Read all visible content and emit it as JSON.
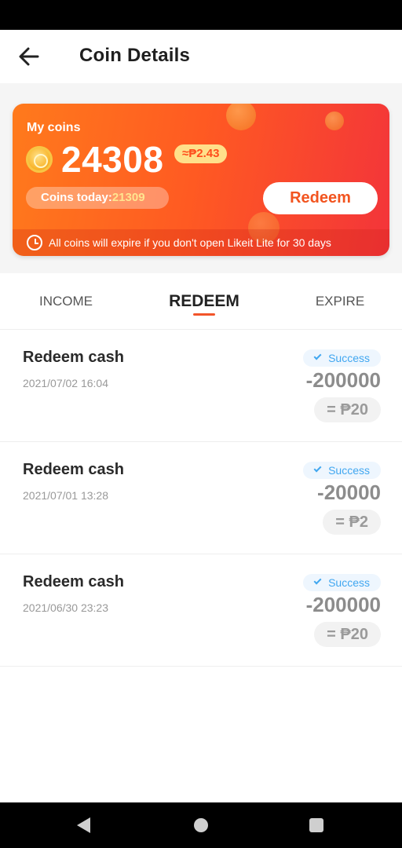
{
  "header": {
    "title": "Coin Details"
  },
  "card": {
    "my_coins_label": "My coins",
    "amount": "24308",
    "approx": "≈₱2.43",
    "today_label": "Coins today:",
    "today_value": "21309",
    "redeem_label": "Redeem",
    "expire_notice": "All coins will expire if you don't open Likeit Lite for 30 days"
  },
  "tabs": [
    {
      "label": "INCOME"
    },
    {
      "label": "REDEEM"
    },
    {
      "label": "EXPIRE"
    }
  ],
  "active_tab": "REDEEM",
  "records": [
    {
      "title": "Redeem cash",
      "date": "2021/07/02 16:04",
      "status": "Success",
      "amount": "-200000",
      "cash": "= ₱20"
    },
    {
      "title": "Redeem cash",
      "date": "2021/07/01 13:28",
      "status": "Success",
      "amount": "-20000",
      "cash": "= ₱2"
    },
    {
      "title": "Redeem cash",
      "date": "2021/06/30 23:23",
      "status": "Success",
      "amount": "-200000",
      "cash": "= ₱20"
    }
  ],
  "colors": {
    "accent": "#f2541f",
    "card_start": "#ff7a1c",
    "card_end": "#f3343a",
    "success": "#41a7f0"
  },
  "icons": {
    "back": "arrow-left-icon",
    "coin": "coin-icon",
    "clock": "clock-icon",
    "check": "check-icon"
  }
}
